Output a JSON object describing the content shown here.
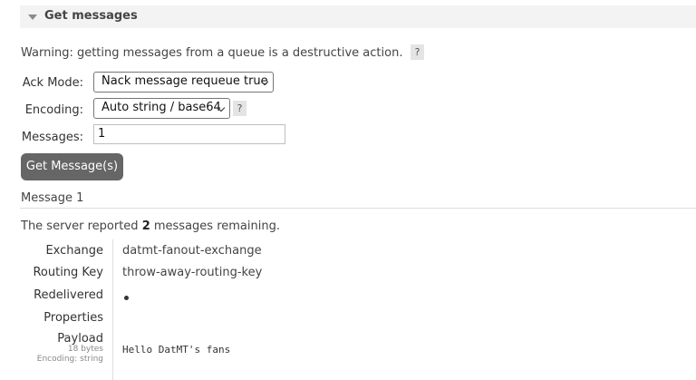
{
  "section": {
    "title": "Get messages"
  },
  "warning": {
    "text": "Warning: getting messages from a queue is a destructive action.",
    "help": "?"
  },
  "form": {
    "ack_mode": {
      "label": "Ack Mode:",
      "value": "Nack message requeue true"
    },
    "encoding": {
      "label": "Encoding:",
      "value": "Auto string / base64",
      "help": "?"
    },
    "messages": {
      "label": "Messages:",
      "value": "1"
    },
    "submit_label": "Get Message(s)"
  },
  "result": {
    "heading": "Message 1",
    "remaining_prefix": "The server reported ",
    "remaining_count": "2",
    "remaining_suffix": " messages remaining.",
    "fields": {
      "exchange": {
        "label": "Exchange",
        "value": "datmt-fanout-exchange"
      },
      "routing_key": {
        "label": "Routing Key",
        "value": "throw-away-routing-key"
      },
      "redelivered": {
        "label": "Redelivered"
      },
      "properties": {
        "label": "Properties"
      },
      "payload": {
        "label": "Payload",
        "size": "18 bytes",
        "encoding": "Encoding: string",
        "value": "Hello DatMT's fans"
      }
    }
  }
}
